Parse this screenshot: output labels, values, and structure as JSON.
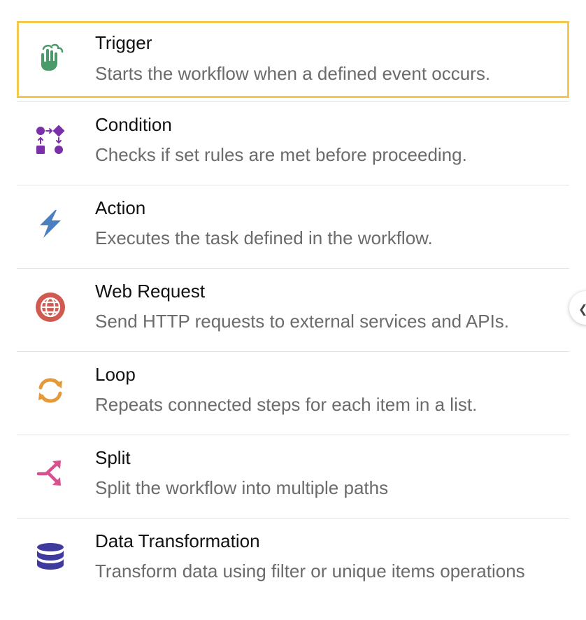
{
  "items": [
    {
      "title": "Trigger",
      "description": "Starts the workflow when a defined event occurs.",
      "icon": "hand-pointer-icon",
      "color": "#4a9a6a",
      "selected": true
    },
    {
      "title": "Condition",
      "description": "Checks if set rules are met before proceeding.",
      "icon": "condition-flow-icon",
      "color": "#7b2fa8"
    },
    {
      "title": "Action",
      "description": "Executes the task defined in the workflow.",
      "icon": "lightning-bolt-icon",
      "color": "#4a7fc1"
    },
    {
      "title": "Web Request",
      "description": "Send HTTP requests to external services and APIs.",
      "icon": "globe-icon",
      "color": "#d05a50"
    },
    {
      "title": "Loop",
      "description": "Repeats connected steps for each item in a list.",
      "icon": "loop-arrows-icon",
      "color": "#e59a3a"
    },
    {
      "title": "Split",
      "description": "Split the workflow into multiple paths",
      "icon": "split-arrows-icon",
      "color": "#d9508f"
    },
    {
      "title": "Data Transformation",
      "description": "Transform data using filter or unique items operations",
      "icon": "database-icon",
      "color": "#3f3a9e"
    }
  ],
  "accent": {
    "selected_border": "#f2c94c",
    "divider": "#e3e3e3"
  }
}
